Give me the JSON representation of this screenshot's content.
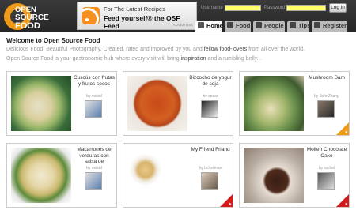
{
  "header": {
    "logo": {
      "line1": "OPEN",
      "line2": "SOURCE",
      "line3": "FOOD"
    },
    "feed_banner": {
      "line1": "For The Latest Recipes",
      "line2": "Feed yourself® the OSF Feed",
      "ad_label": "ADVERTISE"
    },
    "username_label": "Username",
    "password_label": "Password",
    "login_button": "Log in"
  },
  "nav": {
    "tabs": [
      {
        "label": "Home",
        "icon": "home-icon",
        "active": true
      },
      {
        "label": "Food",
        "icon": "fork-icon",
        "active": false
      },
      {
        "label": "People",
        "icon": "people-icon",
        "active": false
      },
      {
        "label": "Tips",
        "icon": "question-icon",
        "active": false
      },
      {
        "label": "Register",
        "icon": "check-icon",
        "active": false
      }
    ]
  },
  "welcome": {
    "title": "Welcome to Open Source Food",
    "line1_pre": "Delicious Food. Beautiful Photography. Created, rated and improved by you and ",
    "line1_bold": "fellow food-lovers",
    "line1_post": " from all over the world.",
    "line2_pre": "Open Source Food is your gastronomic hub where every visit will bring ",
    "line2_bold": "inspiration",
    "line2_post": " and a rumbling belly..."
  },
  "recipes": [
    {
      "title": "Cuscús con frutas y frutos secos",
      "author": "by veisid",
      "badge": "none"
    },
    {
      "title": "Bizcocho de yogur de soja",
      "author": "by cesar",
      "badge": "none"
    },
    {
      "title": "Mushroom Sam",
      "author": "by JohnZhang",
      "badge": "orange"
    },
    {
      "title": "Macarrones de verduras con salsa de berenjena",
      "author": "by veisid",
      "badge": "none"
    },
    {
      "title": "My Friend Friand",
      "author": "by bcherman",
      "badge": "red"
    },
    {
      "title": "Molten Chocolate Cake",
      "author": "by rachel",
      "badge": "red"
    }
  ],
  "colors": {
    "brand": "#f09a1a",
    "header_bg": "#2e2e2e",
    "input_bg": "#ffff66",
    "badge_red": "#d21c1c"
  }
}
